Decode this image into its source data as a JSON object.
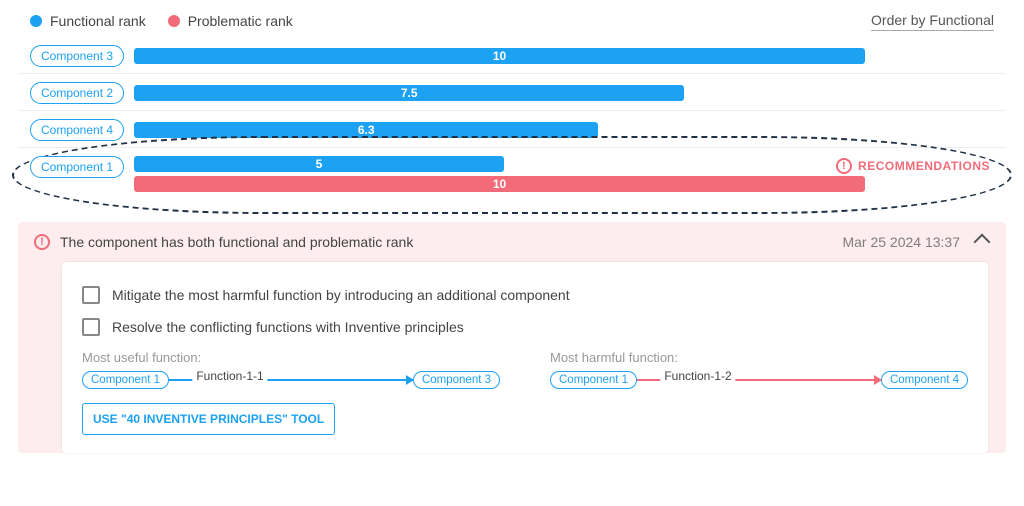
{
  "colors": {
    "functional": "#1da1f2",
    "problematic": "#f16c78"
  },
  "legend": {
    "functional": "Functional rank",
    "problematic": "Problematic rank"
  },
  "orderLabel": "Order by Functional",
  "recommendationsLabel": "RECOMMENDATIONS",
  "chart_data": {
    "type": "bar",
    "xlabel": "",
    "ylabel": "",
    "ylim": [
      0,
      10
    ],
    "categories": [
      "Component 3",
      "Component 2",
      "Component 4",
      "Component 1"
    ],
    "series": [
      {
        "name": "Functional rank",
        "values": [
          10,
          7.5,
          6.3,
          5
        ]
      },
      {
        "name": "Problematic rank",
        "values": [
          null,
          null,
          null,
          10
        ]
      }
    ]
  },
  "rows": [
    {
      "name": "Component 3",
      "func": "10",
      "funcW": 85
    },
    {
      "name": "Component 2",
      "func": "7.5",
      "funcW": 64
    },
    {
      "name": "Component 4",
      "func": "6.3",
      "funcW": 54
    },
    {
      "name": "Component 1",
      "func": "5",
      "funcW": 43,
      "prob": "10",
      "probW": 85,
      "hasRec": true,
      "highlight": true
    }
  ],
  "panel": {
    "title": "The component has both functional and problematic rank",
    "timestamp": "Mar 25 2024 13:37",
    "todo1": "Mitigate the most harmful function by introducing an additional component",
    "todo2": "Resolve the conflicting functions with Inventive principles",
    "usefulLabel": "Most useful function:",
    "harmfulLabel": "Most harmful function:",
    "useful": {
      "from": "Component 1",
      "fn": "Function-1-1",
      "to": "Component 3"
    },
    "harmful": {
      "from": "Component 1",
      "fn": "Function-1-2",
      "to": "Component 4"
    },
    "buttonLabel": "USE \"40 INVENTIVE PRINCIPLES\" TOOL"
  }
}
